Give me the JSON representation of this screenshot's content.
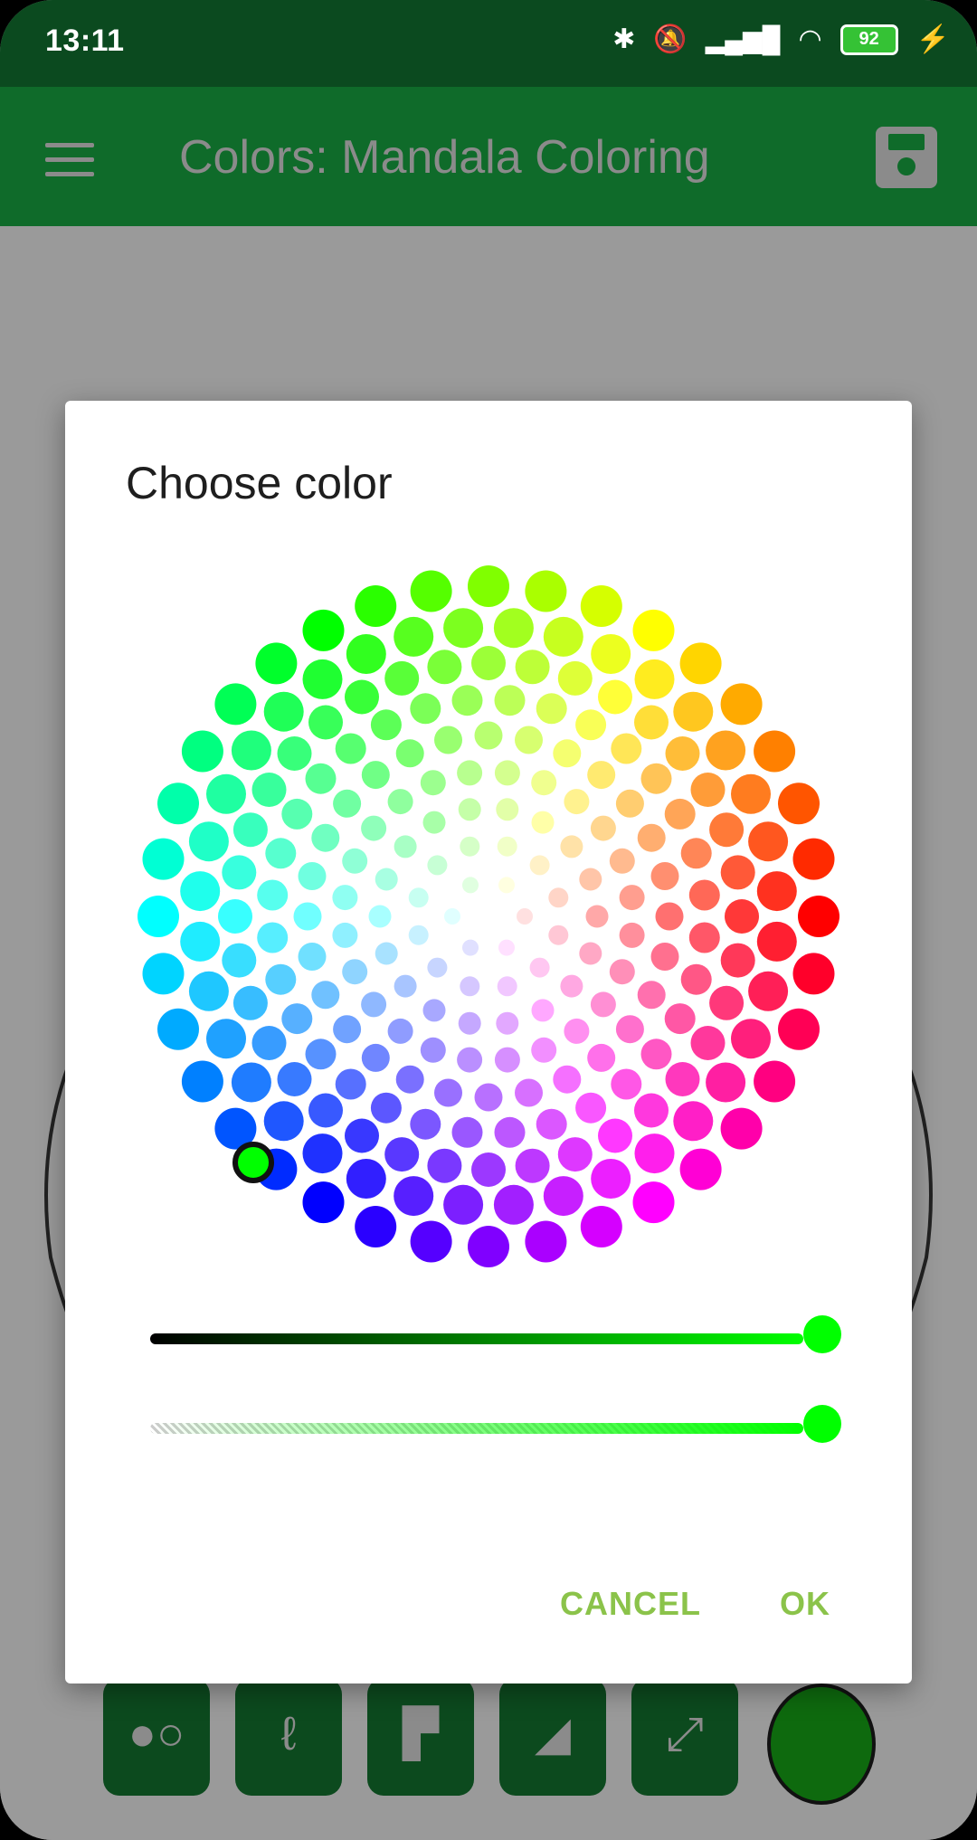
{
  "status_bar": {
    "time": "13:11",
    "battery": "92"
  },
  "app_bar": {
    "title": "Colors: Mandala Coloring",
    "icons": [
      "menu-icon",
      "save-icon"
    ]
  },
  "toolbar": {
    "tools": [
      "stamp-icon",
      "brush-stroke-icon",
      "paint-roller-icon",
      "eraser-icon",
      "fullscreen-icon"
    ],
    "current_color": "#0e6a0e"
  },
  "dialog": {
    "title": "Choose color",
    "cancel_label": "CANCEL",
    "ok_label": "OK",
    "selected_color": "#00ff00",
    "brightness": 1.0,
    "alpha": 1.0
  },
  "colors": {
    "status_bar": "#0b4a1f",
    "app_bar": "#0f6b2a",
    "accent": "#8bc34a"
  }
}
